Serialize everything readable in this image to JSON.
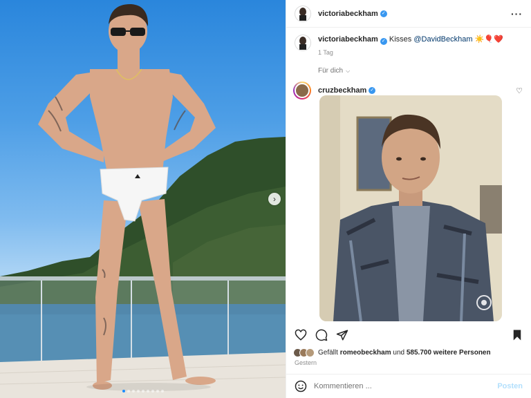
{
  "post": {
    "author": "victoriabeckham",
    "verified": true,
    "more_icon": "more-horizontal-icon"
  },
  "caption": {
    "author": "victoriabeckham",
    "text": "Kisses",
    "mention": "@DavidBeckham",
    "emojis": "☀️🎈❤️",
    "time": "1 Tag"
  },
  "for_you": {
    "label": "Für dich"
  },
  "comment": {
    "author": "cruzbeckham",
    "verified": true
  },
  "photo": {
    "carousel_count": 9,
    "active_index": 0
  },
  "actions": {
    "like_icon": "heart-icon",
    "comment_icon": "comment-icon",
    "share_icon": "send-icon",
    "save_icon": "bookmark-icon"
  },
  "likes": {
    "prefix": "Gefällt",
    "user": "romeobeckham",
    "middle": "und",
    "count": "585.700 weitere Personen"
  },
  "posted": "Gestern",
  "composer": {
    "placeholder": "Kommentieren ...",
    "post_label": "Posten"
  },
  "colors": {
    "verified": "#3897f0",
    "link": "#00376b",
    "post_button": "#b2dffc",
    "carousel_active": "#1a8cff"
  }
}
